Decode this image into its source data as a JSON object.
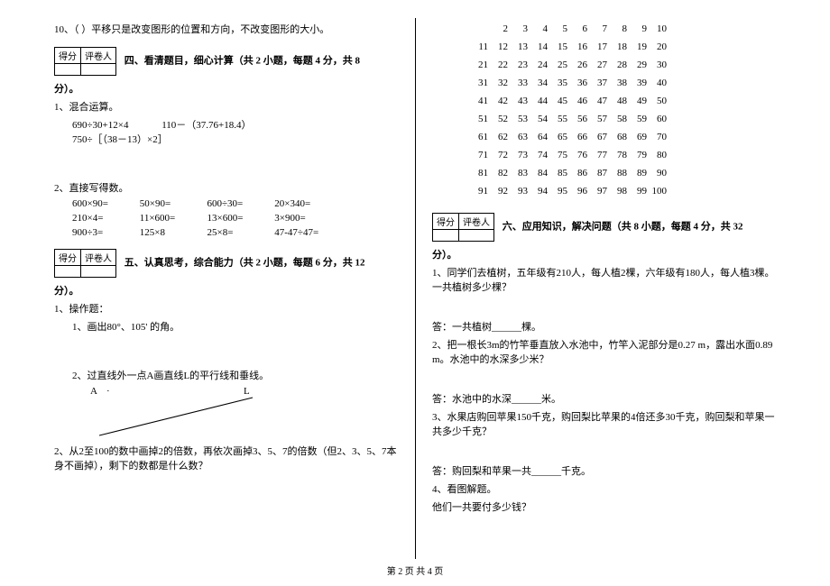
{
  "scorebox": {
    "score": "得分",
    "reviewer": "评卷人"
  },
  "left": {
    "q10": "10、（  ）平移只是改变图形的位置和方向，不改变图形的大小。",
    "sec4": "四、看清题目，细心计算（共 2 小题，每题 4 分，共 8",
    "fen": "分）。",
    "q4_1_label": "1、混合运算。",
    "q4_1_e1": "690÷30+12×4",
    "q4_1_e2": "110－（37.76+18.4）",
    "q4_1_e3": "750÷［（38－13）×2］",
    "q4_2_label": "2、直接写得数。",
    "q4_2": {
      "r1": [
        "600×90=",
        "50×90=",
        "600÷30=",
        "20×340="
      ],
      "r2": [
        "210×4=",
        "11×600=",
        "13×600=",
        "3×900="
      ],
      "r3": [
        "900÷3=",
        "125×8",
        "25×8=",
        "47-47÷47="
      ]
    },
    "sec5": "五、认真思考，综合能力（共 2 小题，每题 6 分，共 12",
    "q5_1_label": "1、操作题：",
    "q5_1_1": "1、画出80°、105' 的角。",
    "q5_1_2": "2、过直线外一点A画直线L的平行线和垂线。",
    "A": "A",
    "dot": "·",
    "L": "L",
    "q5_2": "2、从2至100的数中画掉2的倍数，再依次画掉3、5、7的倍数（但2、3、5、7本身不画掉），剩下的数都是什么数？"
  },
  "right": {
    "numgrid": [
      [
        "2",
        "3",
        "4",
        "5",
        "6",
        "7",
        "8",
        "9",
        "10"
      ],
      [
        "11",
        "12",
        "13",
        "14",
        "15",
        "16",
        "17",
        "18",
        "19",
        "20"
      ],
      [
        "21",
        "22",
        "23",
        "24",
        "25",
        "26",
        "27",
        "28",
        "29",
        "30"
      ],
      [
        "31",
        "32",
        "33",
        "34",
        "35",
        "36",
        "37",
        "38",
        "39",
        "40"
      ],
      [
        "41",
        "42",
        "43",
        "44",
        "45",
        "46",
        "47",
        "48",
        "49",
        "50"
      ],
      [
        "51",
        "52",
        "53",
        "54",
        "55",
        "56",
        "57",
        "58",
        "59",
        "60"
      ],
      [
        "61",
        "62",
        "63",
        "64",
        "65",
        "66",
        "67",
        "68",
        "69",
        "70"
      ],
      [
        "71",
        "72",
        "73",
        "74",
        "75",
        "76",
        "77",
        "78",
        "79",
        "80"
      ],
      [
        "81",
        "82",
        "83",
        "84",
        "85",
        "86",
        "87",
        "88",
        "89",
        "90"
      ],
      [
        "91",
        "92",
        "93",
        "94",
        "95",
        "96",
        "97",
        "98",
        "99",
        "100"
      ]
    ],
    "sec6": "六、应用知识，解决问题（共 8 小题，每题 4 分，共 32",
    "fen": "分）。",
    "q6_1": "1、同学们去植树，五年级有210人，每人植2棵，六年级有180人，每人植3棵。一共植树多少棵？",
    "a6_1": "答：一共植树______棵。",
    "q6_2": "2、把一根长3m的竹竿垂直放入水池中，竹竿入泥部分是0.27 m，露出水面0.89 m。水池中的水深多少米？",
    "a6_2": "答：水池中的水深______米。",
    "q6_3": "3、水果店购回苹果150千克，购回梨比苹果的4倍还多30千克，购回梨和苹果一共多少千克？",
    "a6_3": "答：购回梨和苹果一共______千克。",
    "q6_4a": "4、看图解题。",
    "q6_4b": "他们一共要付多少钱？"
  },
  "footer": "第 2 页  共 4 页"
}
